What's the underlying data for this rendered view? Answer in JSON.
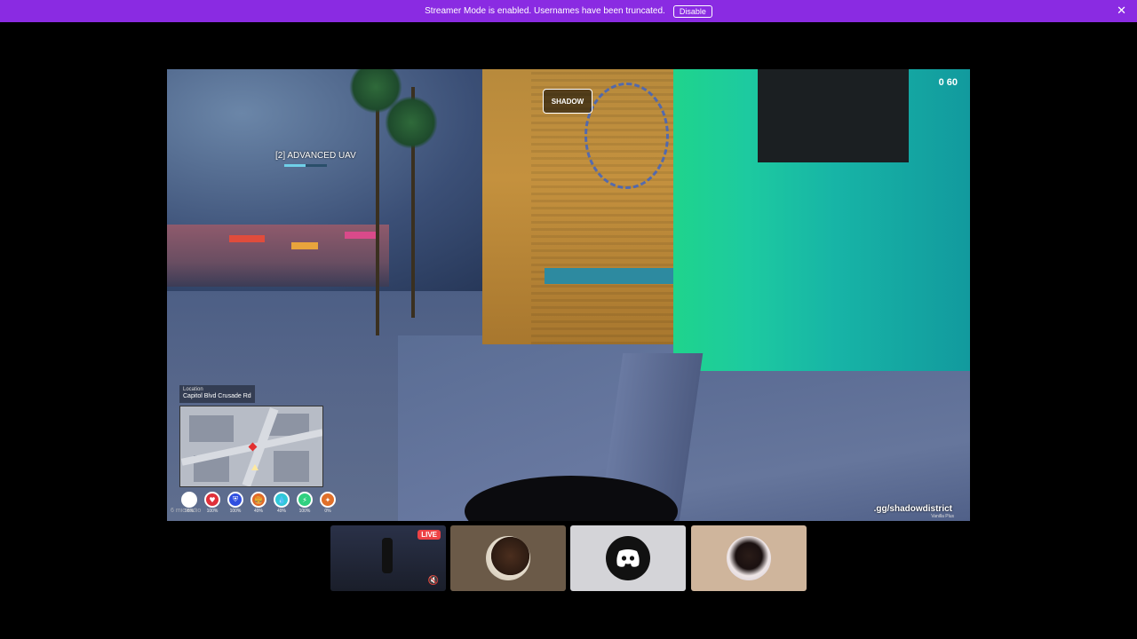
{
  "banner": {
    "message": "Streamer Mode is enabled. Usernames have been truncated.",
    "disable_label": "Disable",
    "close_icon": "✕"
  },
  "game": {
    "uav_label": "[2] ADVANCED UAV",
    "uav_progress": 0.5,
    "fps": "0 60",
    "logo_text": "SHADOW",
    "location_title": "Location",
    "location_value": "Capitol Blvd Crusade Rd",
    "radio_note": "6 mic radio",
    "discord_link": ".gg/shadowdistrict",
    "server_sub": "Vanilla Plus",
    "status": [
      {
        "icon": "mic-icon",
        "glyph": "🎙",
        "pct": "98%",
        "color": "#ffffff"
      },
      {
        "icon": "health-icon",
        "glyph": "♥",
        "pct": "100%",
        "color": "#e0303a"
      },
      {
        "icon": "armor-icon",
        "glyph": "⛨",
        "pct": "100%",
        "color": "#3050e0"
      },
      {
        "icon": "hunger-icon",
        "glyph": "🍔",
        "pct": "49%",
        "color": "#e06a2a"
      },
      {
        "icon": "thirst-icon",
        "glyph": "💧",
        "pct": "49%",
        "color": "#30c8d8"
      },
      {
        "icon": "stamina-icon",
        "glyph": "⚡",
        "pct": "100%",
        "color": "#30d080"
      },
      {
        "icon": "stress-icon",
        "glyph": "✦",
        "pct": "0%",
        "color": "#e0702a"
      }
    ]
  },
  "participants": {
    "live_label": "LIVE",
    "mute_icon": "🔇"
  }
}
